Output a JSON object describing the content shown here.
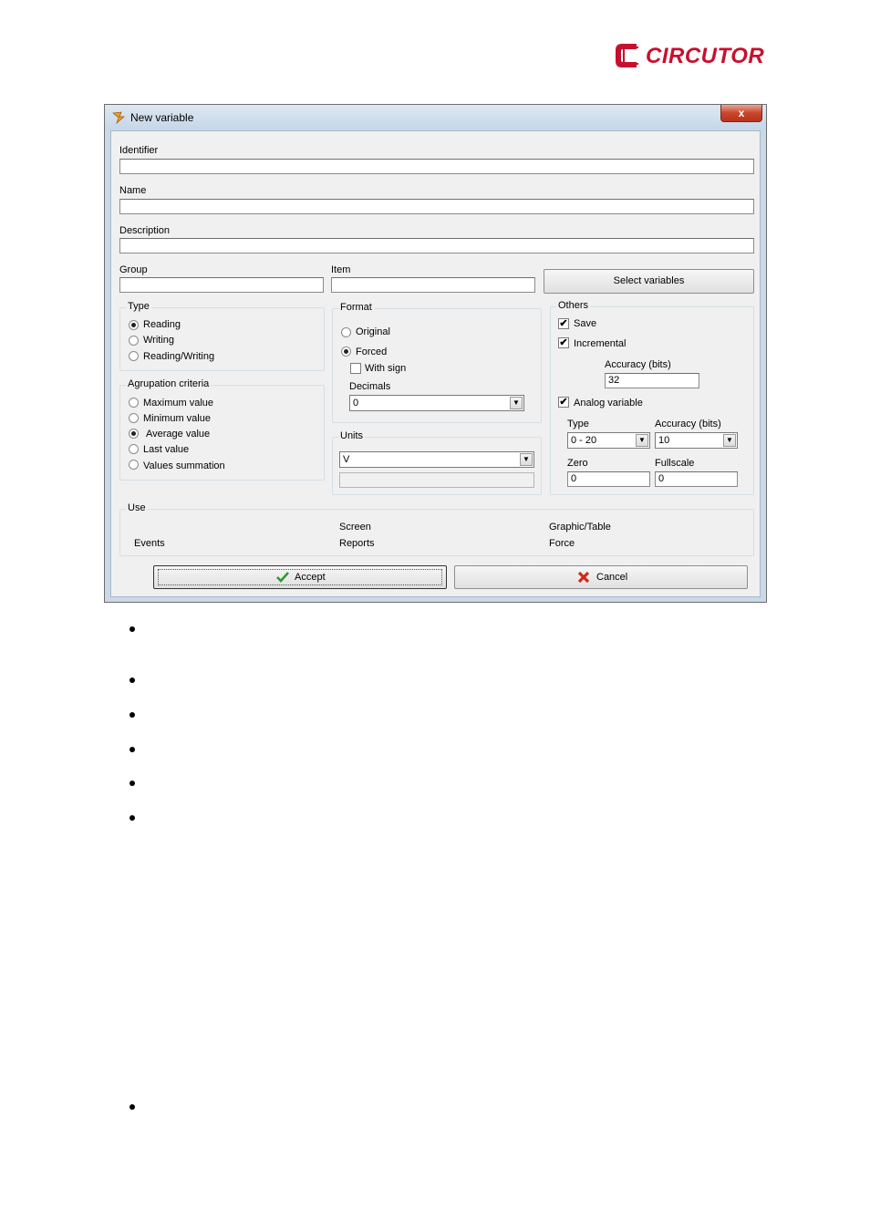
{
  "logo": {
    "text": "CIRCUTOR",
    "color": "#c8102e"
  },
  "window": {
    "title": "New variable",
    "close_label": "x"
  },
  "fields": {
    "identifier_label": "Identifier",
    "identifier_value": "",
    "name_label": "Name",
    "name_value": "",
    "description_label": "Description",
    "description_value": "",
    "group_label": "Group",
    "group_value": "",
    "item_label": "Item",
    "item_value": "",
    "select_variables_label": "Select  variables"
  },
  "type": {
    "title": "Type",
    "options": [
      "Reading",
      "Writing",
      "Reading/Writing"
    ],
    "selected": "Reading"
  },
  "agrupation": {
    "title": "Agrupation criteria",
    "options": [
      "Maximum value",
      "Minimum value",
      "Average value",
      "Last value",
      "Values summation"
    ],
    "selected": "Average value"
  },
  "format": {
    "title": "Format",
    "original_label": "Original",
    "forced_label": "Forced",
    "selected": "Forced",
    "with_sign_label": "With sign",
    "with_sign_checked": false,
    "decimals_label": "Decimals",
    "decimals_value": "0"
  },
  "units": {
    "title": "Units",
    "value": "V",
    "extra_value": ""
  },
  "others": {
    "title": "Others",
    "save_label": "Save",
    "save_checked": true,
    "incremental_label": "Incremental",
    "incremental_checked": true,
    "accuracy_label": "Accuracy (bits)",
    "accuracy_value": "32",
    "analog_label": "Analog variable",
    "analog_checked": true,
    "type_label": "Type",
    "type_value": "0 - 20",
    "accuracy2_label": "Accuracy (bits)",
    "accuracy2_value": "10",
    "zero_label": "Zero",
    "zero_value": "0",
    "fullscale_label": "Fullscale",
    "fullscale_value": "0"
  },
  "use": {
    "title": "Use",
    "screen": "Screen",
    "graphic_table": "Graphic/Table",
    "events": "Events",
    "reports": "Reports",
    "force": "Force"
  },
  "buttons": {
    "accept_label": "Accept",
    "cancel_label": "Cancel"
  },
  "icons": {
    "check": "✔",
    "arrow_down": "▼",
    "accept_icon": "green-check-icon",
    "cancel_icon": "red-x-icon"
  }
}
